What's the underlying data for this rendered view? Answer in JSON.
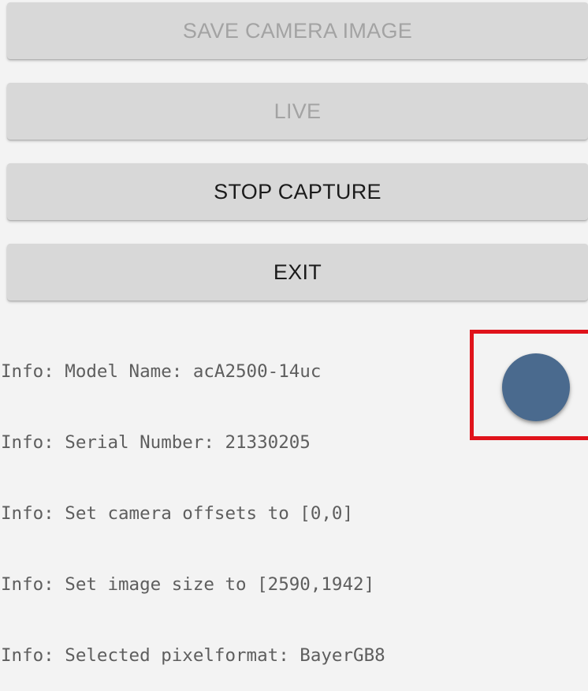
{
  "buttons": {
    "save_camera_image": "SAVE CAMERA IMAGE",
    "live": "LIVE",
    "stop_capture": "STOP CAPTURE",
    "exit": "EXIT"
  },
  "log": {
    "lines": [
      "Info: Model Name: acA2500-14uc",
      "Info: Serial Number: 21330205",
      "Info: Set camera offsets to [0,0]",
      "Info: Set image size to [2590,1942]",
      "Info: Selected pixelformat: BayerGB8"
    ]
  },
  "fab": {
    "icon": "circle-action-icon",
    "color": "#4a6a8e"
  },
  "highlight": {
    "color": "#e0131b"
  },
  "colors": {
    "background": "#f3f3f3",
    "button_bg": "#d8d8d8",
    "text_disabled": "#a3a3a3",
    "text_enabled": "#1b1b1b",
    "log_text": "#5e5e5e"
  }
}
